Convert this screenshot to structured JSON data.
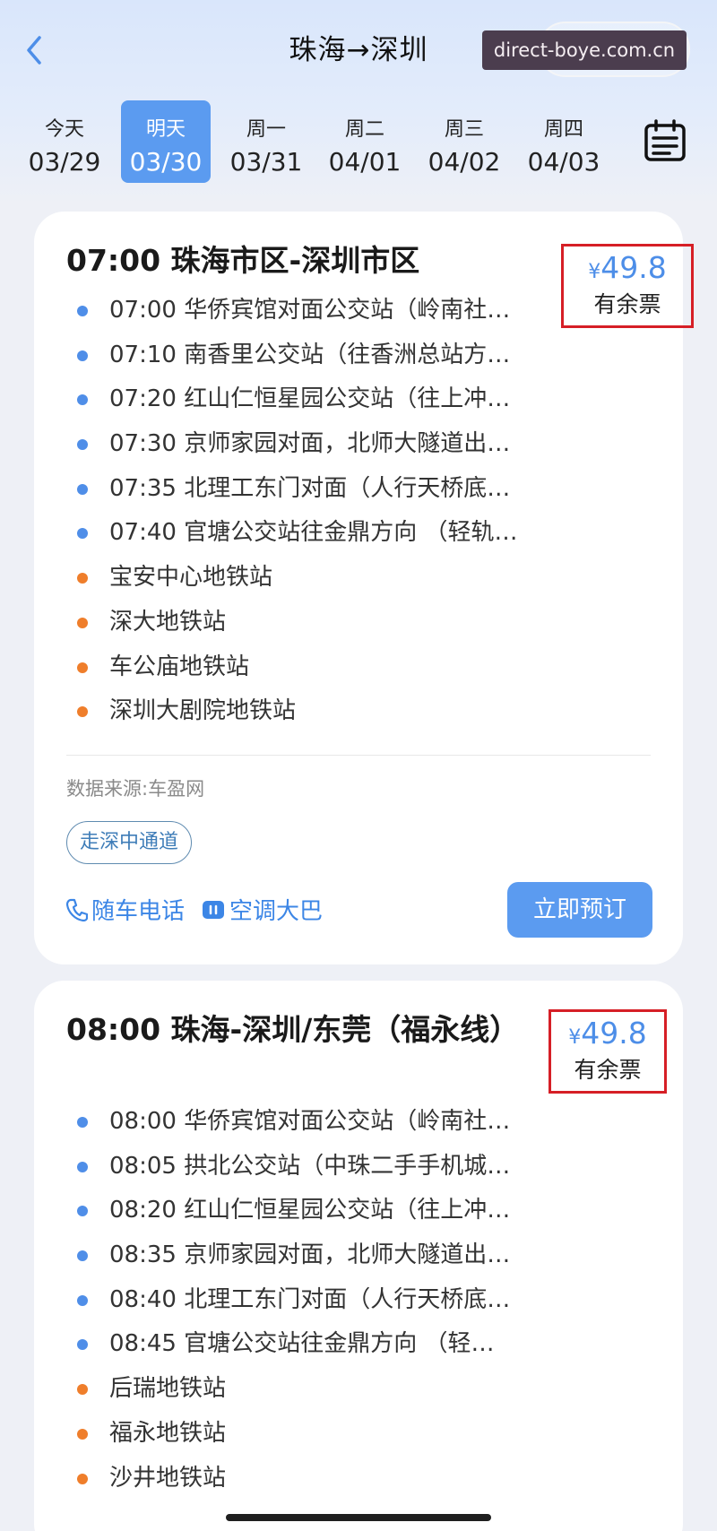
{
  "header": {
    "title": "珠海→深圳",
    "watermark": "direct-boye.com.cn"
  },
  "dates": [
    {
      "weekday": "今天",
      "date": "03/29",
      "active": false
    },
    {
      "weekday": "明天",
      "date": "03/30",
      "active": true
    },
    {
      "weekday": "周一",
      "date": "03/31",
      "active": false
    },
    {
      "weekday": "周二",
      "date": "04/01",
      "active": false
    },
    {
      "weekday": "周三",
      "date": "04/02",
      "active": false
    },
    {
      "weekday": "周四",
      "date": "04/03",
      "active": false
    }
  ],
  "routes": [
    {
      "title": "07:00 珠海市区-深圳市区",
      "currency": "¥",
      "price": "49.8",
      "availability": "有余票",
      "stops": [
        {
          "text": "07:00 华侨宾馆对面公交站（岭南社…",
          "color": "blue"
        },
        {
          "text": "07:10 南香里公交站（往香洲总站方…",
          "color": "blue"
        },
        {
          "text": "07:20 红山仁恒星园公交站（往上冲…",
          "color": "blue"
        },
        {
          "text": "07:30 京师家园对面，北师大隧道出…",
          "color": "blue"
        },
        {
          "text": "07:35 北理工东门对面（人行天桥底…",
          "color": "blue"
        },
        {
          "text": "07:40 官塘公交站往金鼎方向 （轻轨…",
          "color": "blue"
        },
        {
          "text": "宝安中心地铁站",
          "color": "orange"
        },
        {
          "text": "深大地铁站",
          "color": "orange"
        },
        {
          "text": "车公庙地铁站",
          "color": "orange"
        },
        {
          "text": "深圳大剧院地铁站",
          "color": "orange"
        }
      ],
      "source": "数据来源:车盈网",
      "tag": "走深中通道",
      "phone": "随车电话",
      "ac": "空调大巴",
      "book": "立即预订"
    },
    {
      "title": "08:00 珠海-深圳/东莞（福永线）",
      "currency": "¥",
      "price": "49.8",
      "availability": "有余票",
      "stops": [
        {
          "text": "08:00 华侨宾馆对面公交站（岭南社…",
          "color": "blue"
        },
        {
          "text": "08:05 拱北公交站（中珠二手手机城…",
          "color": "blue"
        },
        {
          "text": "08:20 红山仁恒星园公交站（往上冲…",
          "color": "blue"
        },
        {
          "text": "08:35 京师家园对面，北师大隧道出…",
          "color": "blue"
        },
        {
          "text": "08:40 北理工东门对面（人行天桥底…",
          "color": "blue"
        },
        {
          "text": "08:45 官塘公交站往金鼎方向 （轻…",
          "color": "blue"
        },
        {
          "text": "后瑞地铁站",
          "color": "orange"
        },
        {
          "text": "福永地铁站",
          "color": "orange"
        },
        {
          "text": "沙井地铁站",
          "color": "orange"
        }
      ]
    }
  ]
}
